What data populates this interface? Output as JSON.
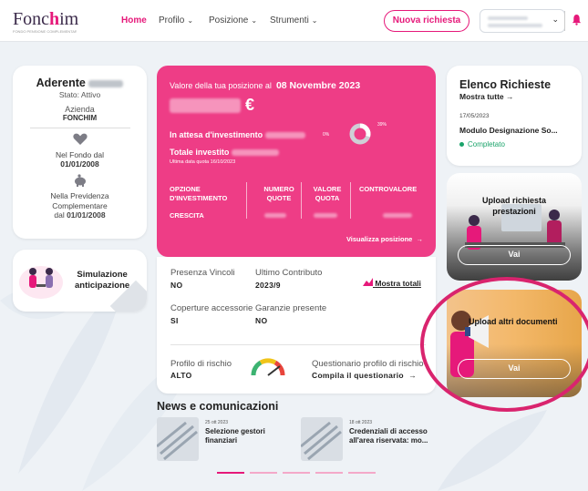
{
  "header": {
    "logo_text_a": "Fonc",
    "logo_text_b": "h",
    "logo_text_c": "im",
    "logo_sub": "FONDO PENSIONE COMPLEMENTARE",
    "nav": [
      {
        "label": "Home",
        "has_chevron": false,
        "active": true
      },
      {
        "label": "Profilo",
        "has_chevron": true,
        "active": false
      },
      {
        "label": "Posizione",
        "has_chevron": true,
        "active": false
      },
      {
        "label": "Strumenti",
        "has_chevron": true,
        "active": false
      }
    ],
    "chevron": "⌄",
    "new_request_label": "Nuova richiesta"
  },
  "profile": {
    "title": "Aderente",
    "status": "Stato: Attivo",
    "company_label": "Azienda",
    "company": "FONCHIM",
    "fund_label": "Nel Fondo dal",
    "fund_date": "01/01/2008",
    "pension_label_1": "Nella Previdenza",
    "pension_label_2": "Complementare",
    "pension_label_3": "dal",
    "pension_date": "01/01/2008"
  },
  "simulation": {
    "label_1": "Simulazione",
    "label_2": "anticipazione"
  },
  "position": {
    "title_prefix": "Valore della tua posizione al",
    "date": "08 Novembre 2023",
    "amount_suffix": "€",
    "waiting_label": "In attesa d'investimento",
    "pct_small": "0%",
    "pct_right": "39%",
    "invested_label": "Totale investito",
    "quota_date": "Ultima data quota 16/10/2023",
    "cols": [
      "OPZIONE D'INVESTIMENTO",
      "NUMERO QUOTE",
      "VALORE QUOTA",
      "CONTROVALORE"
    ],
    "row_option": "CRESCITA",
    "view_link": "Visualizza posizione",
    "arrow": "→"
  },
  "details": {
    "constraints_label": "Presenza Vincoli",
    "constraints_value": "NO",
    "last_contrib_label": "Ultimo Contributo",
    "last_contrib_value": "2023/9",
    "show_totals": "Mostra totali",
    "coverage_label": "Coperture accessorie",
    "coverage_value": "SI",
    "guarantee_label": "Garanzie presente",
    "guarantee_value": "NO",
    "risk_label": "Profilo di rischio",
    "risk_value": "ALTO",
    "questionnaire_label": "Questionario profilo di rischio",
    "questionnaire_link": "Compila il questionario",
    "arrow": "→"
  },
  "news": {
    "title": "News e comunicazioni",
    "items": [
      {
        "date": "25 ott 2023",
        "title_1": "Selezione gestori",
        "title_2": "finanziari"
      },
      {
        "date": "18 ott 2023",
        "title_1": "Credenziali di accesso",
        "title_2": "all'area riservata: mo..."
      }
    ]
  },
  "requests": {
    "title": "Elenco Richieste",
    "show_all": "Mostra tutte",
    "arrow": "→",
    "date": "17/05/2023",
    "name": "Modulo Designazione So...",
    "status": "Completato"
  },
  "upload1": {
    "title_1": "Upload richiesta",
    "title_2": "prestazioni",
    "button": "Vai"
  },
  "upload2": {
    "title": "Upload altri documenti",
    "button": "Vai"
  },
  "colors": {
    "accent": "#e6197a",
    "pink_card": "#ee3d86",
    "success": "#1aa36a",
    "highlight": "#d9246e"
  }
}
